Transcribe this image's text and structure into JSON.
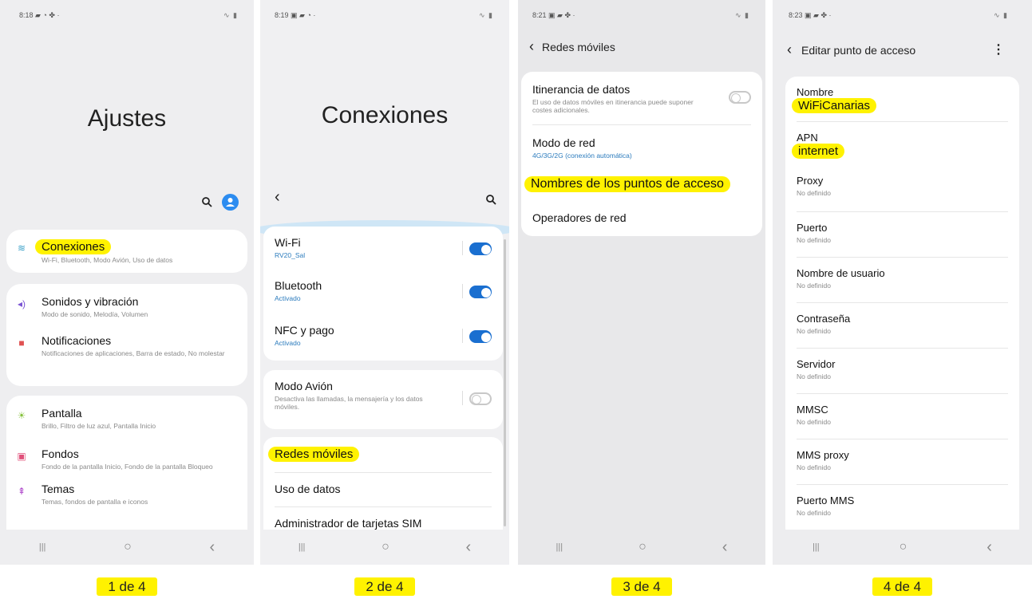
{
  "screen1": {
    "status_time": "8:18",
    "status_icons": "▰ ◔ ✤ ·",
    "status_right": "∿ ▮",
    "title": "Ajustes",
    "items": [
      {
        "label": "Conexiones",
        "sub": "Wi-Fi, Bluetooth, Modo Avión, Uso de datos",
        "icon_color": "#3aa0c8"
      },
      {
        "label": "Sonidos y vibración",
        "sub": "Modo de sonido, Melodía, Volumen",
        "icon_color": "#7b55d4"
      },
      {
        "label": "Notificaciones",
        "sub": "Notificaciones de aplicaciones, Barra de estado, No molestar",
        "icon_color": "#e05252"
      },
      {
        "label": "Pantalla",
        "sub": "Brillo, Filtro de luz azul, Pantalla Inicio",
        "icon_color": "#86c13c"
      },
      {
        "label": "Fondos",
        "sub": "Fondo de la pantalla Inicio, Fondo de la pantalla Bloqueo",
        "icon_color": "#e0507a"
      },
      {
        "label": "Temas",
        "sub": "Temas, fondos de pantalla e iconos",
        "icon_color": "#b04ccc"
      }
    ],
    "caption": "1 de 4"
  },
  "screen2": {
    "status_time": "8:19",
    "status_icons": "▣ ▰ ◔ ·",
    "status_right": "∿ ▮",
    "title": "Conexiones",
    "items": [
      {
        "label": "Wi-Fi",
        "sub": "RV20_Sal"
      },
      {
        "label": "Bluetooth",
        "sub": "Activado"
      },
      {
        "label": "NFC y pago",
        "sub": "Activado"
      },
      {
        "label": "Modo Avión",
        "sub": "Desactiva las llamadas, la mensajería y los datos móviles."
      },
      {
        "label": "Redes móviles"
      },
      {
        "label": "Uso de datos"
      },
      {
        "label": "Administrador de tarjetas SIM"
      }
    ],
    "caption": "2 de 4"
  },
  "screen3": {
    "status_time": "8:21",
    "status_icons": "▣ ▰ ✤ ·",
    "status_right": "∿ ▮",
    "title": "Redes móviles",
    "items": [
      {
        "label": "Itinerancia de datos",
        "sub": "El uso de datos móviles en itinerancia puede suponer costes adicionales."
      },
      {
        "label": "Modo de red",
        "sub": "4G/3G/2G (conexión automática)"
      },
      {
        "label": "Nombres de los puntos de acceso"
      },
      {
        "label": "Operadores de red"
      }
    ],
    "caption": "3 de 4"
  },
  "screen4": {
    "status_time": "8:23",
    "status_icons": "▣ ▰ ✤ ·",
    "status_right": "∿ ▮",
    "title": "Editar punto de acceso",
    "fields": [
      {
        "label": "Nombre",
        "value": "WiFiCanarias"
      },
      {
        "label": "APN",
        "value": "internet"
      },
      {
        "label": "Proxy",
        "value": "No definido"
      },
      {
        "label": "Puerto",
        "value": "No definido"
      },
      {
        "label": "Nombre de usuario",
        "value": "No definido"
      },
      {
        "label": "Contraseña",
        "value": "No definido"
      },
      {
        "label": "Servidor",
        "value": "No definido"
      },
      {
        "label": "MMSC",
        "value": "No definido"
      },
      {
        "label": "MMS proxy",
        "value": "No definido"
      },
      {
        "label": "Puerto MMS",
        "value": "No definido"
      }
    ],
    "caption": "4 de 4"
  },
  "nav": {
    "recent": "|||",
    "home": "○",
    "back": "‹"
  }
}
